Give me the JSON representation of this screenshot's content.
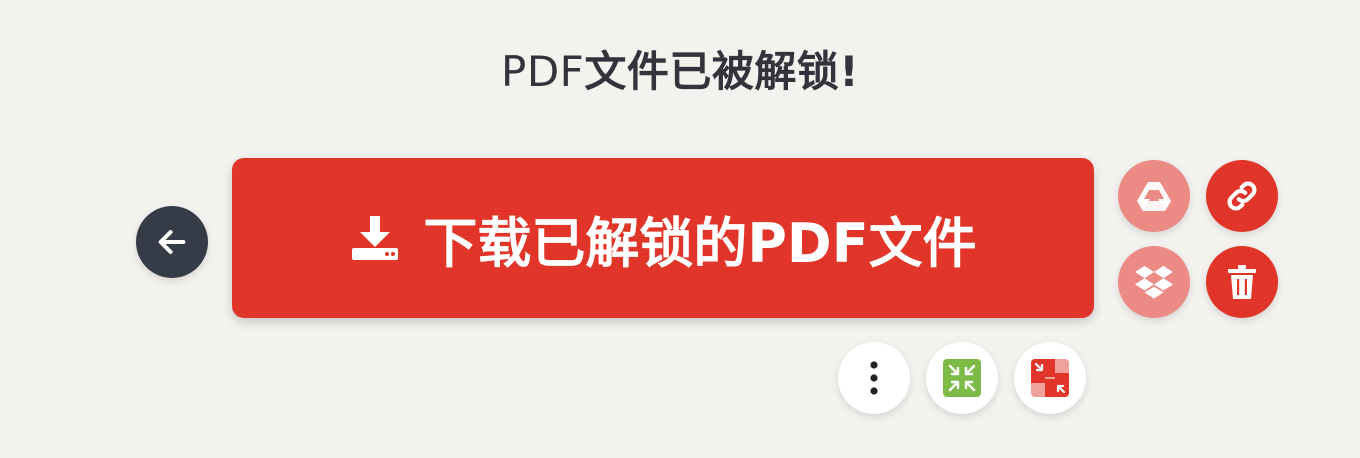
{
  "header": {
    "title_latin": "PDF",
    "title_cjk": "文件已被解锁!"
  },
  "main": {
    "download_label": "下载已解锁的PDF文件"
  },
  "icons": {
    "back": "arrow-left-icon",
    "download": "download-icon",
    "gdrive": "google-drive-icon",
    "link": "link-icon",
    "dropbox": "dropbox-icon",
    "trash": "trash-icon",
    "more": "more-vertical-icon",
    "compress": "compress-icon",
    "merge": "merge-icon"
  },
  "colors": {
    "background": "#f3f2ef",
    "accent": "#e2352a",
    "accent_light": "#ec8a85",
    "dark": "#363b48",
    "compress_tile": "#7dbb47",
    "merge_tile": "#e2352a"
  }
}
